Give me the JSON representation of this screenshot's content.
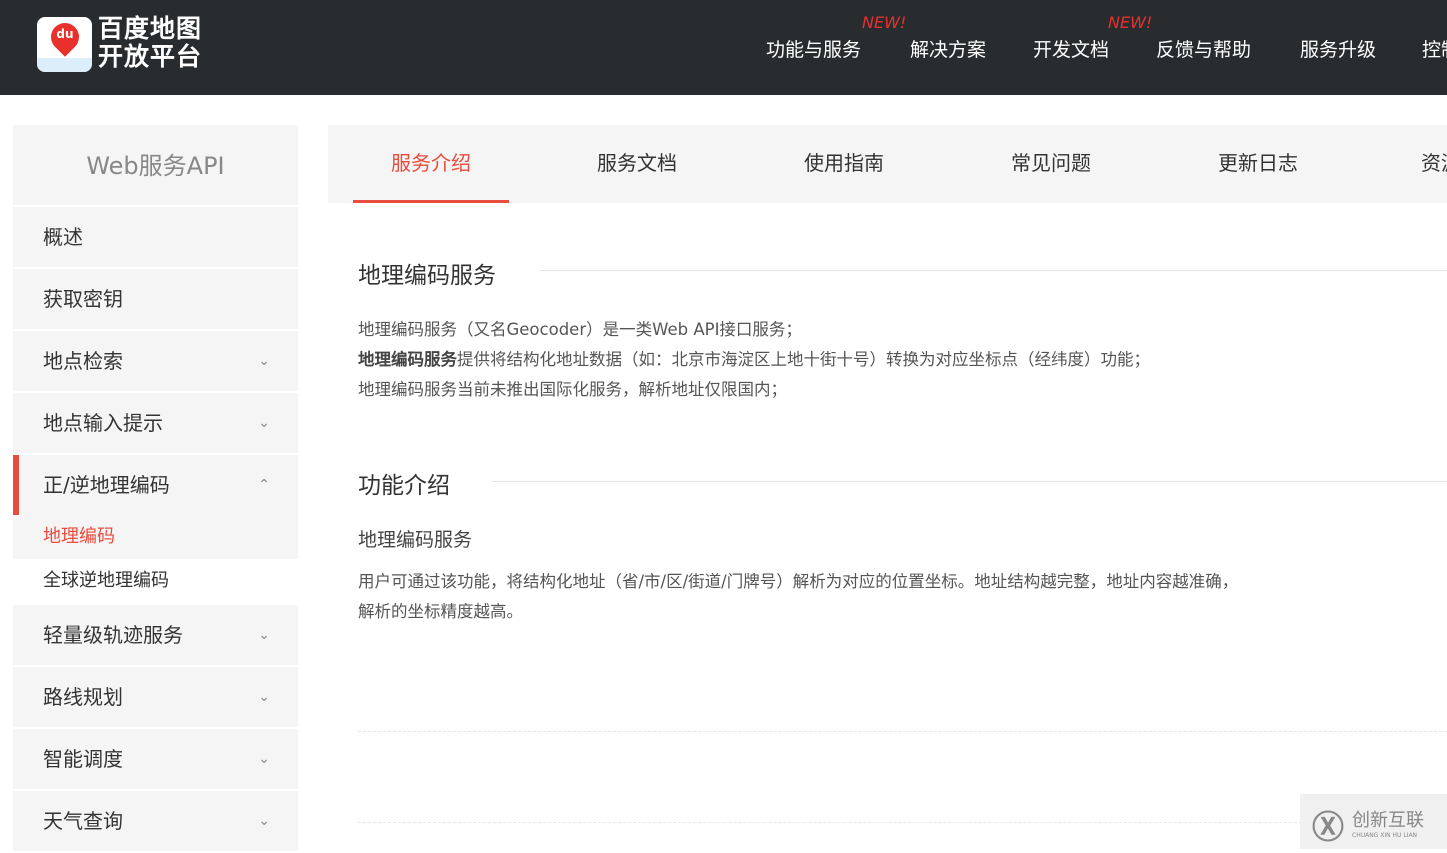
{
  "header": {
    "logo_text": [
      "百度地图",
      "开放平台"
    ],
    "logo_mark": "du",
    "nav": [
      {
        "label": "功能与服务",
        "badge": "NEW!"
      },
      {
        "label": "解决方案"
      },
      {
        "label": "开发文档",
        "badge": "NEW!"
      },
      {
        "label": "反馈与帮助"
      },
      {
        "label": "服务升级"
      },
      {
        "label": "控制台"
      }
    ]
  },
  "sidebar": {
    "title": "Web服务API",
    "items": [
      {
        "label": "概述"
      },
      {
        "label": "获取密钥"
      },
      {
        "label": "地点检索",
        "chevron": "down"
      },
      {
        "label": "地点输入提示",
        "chevron": "down"
      },
      {
        "label": "正/逆地理编码",
        "chevron": "up",
        "active": true,
        "children": [
          "地理编码",
          "全球逆地理编码"
        ]
      },
      {
        "label": "轻量级轨迹服务",
        "chevron": "down"
      },
      {
        "label": "路线规划",
        "chevron": "down"
      },
      {
        "label": "智能调度",
        "chevron": "down"
      },
      {
        "label": "天气查询",
        "chevron": "down"
      }
    ]
  },
  "tabs": [
    "服务介绍",
    "服务文档",
    "使用指南",
    "常见问题",
    "更新日志",
    "资源下载"
  ],
  "content": {
    "h1": "地理编码服务",
    "intro": [
      "地理编码服务（又名Geocoder）是一类Web API接口服务；",
      "地理编码服务",
      "提供将结构化地址数据（如：北京市海淀区上地十街十号）转换为对应坐标点（经纬度）功能；",
      "地理编码服务当前未推出国际化服务，解析地址仅限国内；"
    ],
    "h2": "功能介绍",
    "sub": "地理编码服务",
    "desc": [
      "用户可通过该功能，将结构化地址（省/市/区/街道/门牌号）解析为对应的位置坐标。地址结构越完整，地址内容越准确，",
      "解析的坐标精度越高。"
    ]
  },
  "watermark": {
    "text": "创新互联",
    "sub": "CHUANG XIN HU LIAN"
  }
}
